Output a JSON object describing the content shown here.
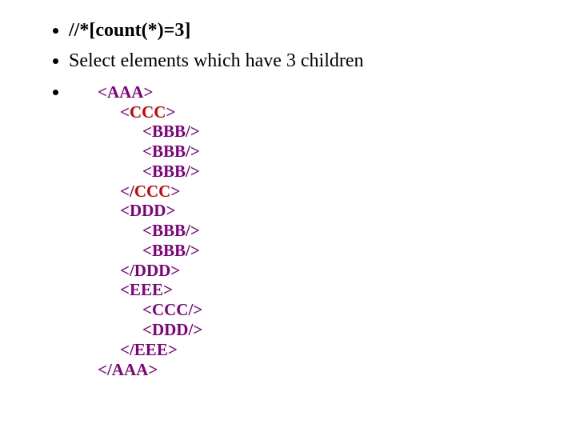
{
  "bullets": {
    "xpath": "//*[count(*)=3]",
    "desc": "Select elements which have 3 children"
  },
  "code": {
    "l01a": "<AAA",
    "l01b": ">",
    "l02a": "<",
    "l02b": "CCC",
    "l02c": ">",
    "l03": "<BBB/>",
    "l04": "<BBB/>",
    "l05": "<BBB/>",
    "l06a": "</",
    "l06b": "CCC",
    "l06c": ">",
    "l07": "<DDD>",
    "l08": "<BBB/>",
    "l09": "<BBB/>",
    "l10": "</DDD>",
    "l11": "<EEE>",
    "l12": "<CCC/>",
    "l13": "<DDD/>",
    "l14": "</EEE>",
    "l15a": "</AAA",
    "l15b": ">"
  }
}
